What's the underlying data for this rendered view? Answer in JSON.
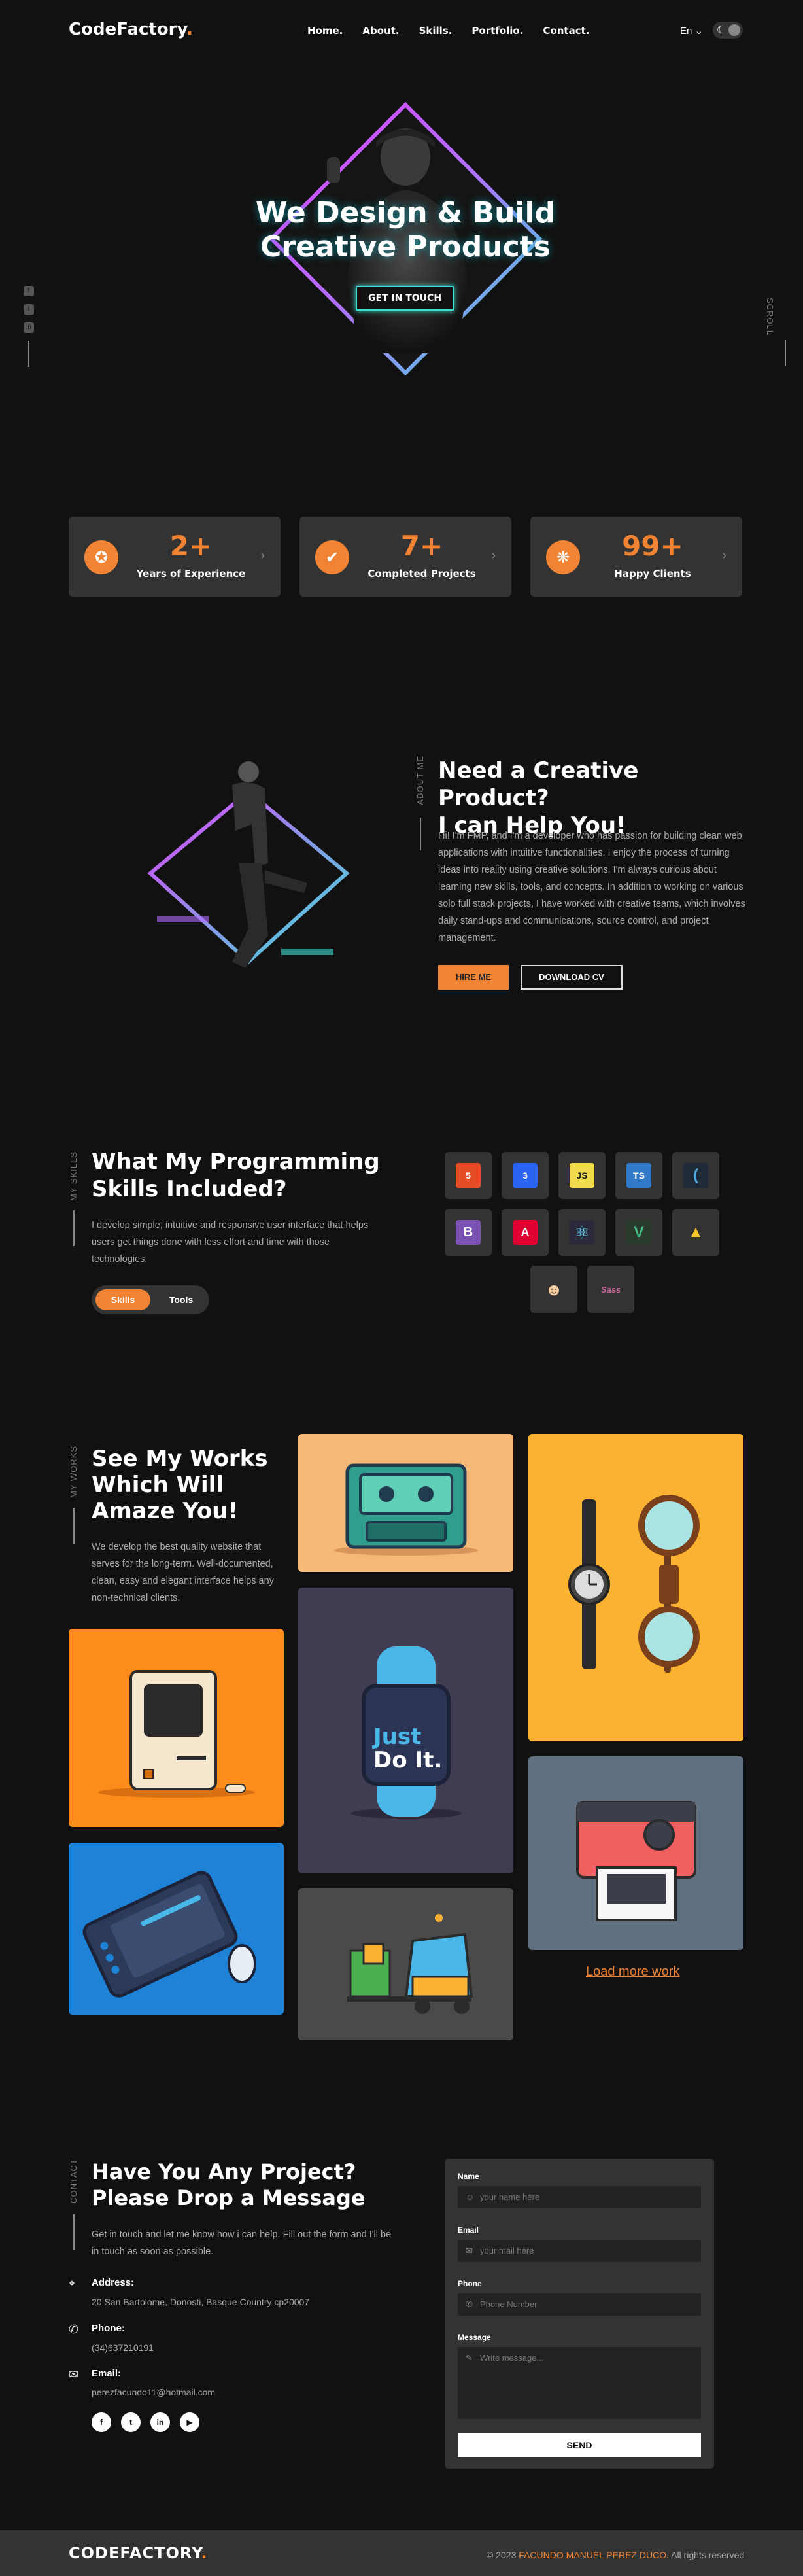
{
  "header": {
    "logo": "CodeFactory",
    "logo_dot": ".",
    "nav": [
      "Home.",
      "About.",
      "Skills.",
      "Portfolio.",
      "Contact."
    ],
    "lang": "En ⌄"
  },
  "side": {
    "scroll": "SCROLL"
  },
  "hero": {
    "title_line1": "We Design & Build",
    "title_line2": "Creative Products",
    "cta": "GET IN TOUCH"
  },
  "stats": [
    {
      "value": "2+",
      "label": "Years of Experience",
      "icon": "award-icon"
    },
    {
      "value": "7+",
      "label": "Completed Projects",
      "icon": "check-badge-icon"
    },
    {
      "value": "99+",
      "label": "Happy Clients",
      "icon": "group-icon"
    }
  ],
  "about": {
    "side": "ABOUT ME",
    "title_line1": "Need a Creative Product?",
    "title_line2": "I can Help You!",
    "text": "Hi! I'm FMP, and I'm a developer who has passion for building clean web applications with intuitive functionalities. I enjoy the process of turning ideas into reality using creative solutions. I'm always curious about learning new skills, tools, and concepts. In addition to working on various solo full stack projects, I have worked with creative teams, which involves daily stand-ups and communications, source control, and project management.",
    "hire": "HIRE ME",
    "cv": "DOWNLOAD CV"
  },
  "skills": {
    "side": "MY SKILLS",
    "title_line1": "What My Programming",
    "title_line2": "Skills Included?",
    "text": "I develop simple, intuitive and responsive user interface that helps users get things done with less effort and time with those technologies.",
    "tab_skills": "Skills",
    "tab_tools": "Tools",
    "items": [
      {
        "name": "html5-icon",
        "glyph": "5",
        "color": "#e44d26"
      },
      {
        "name": "css3-icon",
        "glyph": "3",
        "color": "#2965f1"
      },
      {
        "name": "javascript-icon",
        "glyph": "JS",
        "color": "#f0db4f"
      },
      {
        "name": "typescript-icon",
        "glyph": "TS",
        "color": "#3178c6"
      },
      {
        "name": "jquery-icon",
        "glyph": "(",
        "color": "#1e2a38"
      },
      {
        "name": "bootstrap-icon",
        "glyph": "B",
        "color": "#7952b3"
      },
      {
        "name": "angular-icon",
        "glyph": "A",
        "color": "#dd0031"
      },
      {
        "name": "react-icon",
        "glyph": "⚛",
        "color": "#2a2a3a"
      },
      {
        "name": "vue-icon",
        "glyph": "V",
        "color": "#2a3a2a"
      },
      {
        "name": "firebase-icon",
        "glyph": "▲",
        "color": "#ffca28"
      },
      {
        "name": "github-icon",
        "glyph": "☻",
        "color": "#2a2a2a"
      },
      {
        "name": "sass-icon",
        "glyph": "Sass",
        "color": "#2a2a2a"
      }
    ]
  },
  "works": {
    "side": "MY WORKS",
    "title_line1": "See My Works",
    "title_line2": "Which Will",
    "title_line3": "Amaze You!",
    "text": "We develop the best quality website that serves for the long-term. Well-documented, clean, easy and elegant interface helps any non-technical clients.",
    "watch_text_1": "Just",
    "watch_text_2": "Do It.",
    "load_more": "Load more work"
  },
  "contact": {
    "side": "CONTACT",
    "title_line1": "Have You Any Project?",
    "title_line2": "Please Drop a Message",
    "text": "Get in touch and let me know how i can help. Fill out the form and I'll be in touch as soon as possible.",
    "address_label": "Address:",
    "address": "20 San Bartolome, Donosti, Basque Country cp20007",
    "phone_label": "Phone:",
    "phone": "(34)637210191",
    "email_label": "Email:",
    "email": "perezfacundo11@hotmail.com",
    "socials": [
      "f",
      "t",
      "in",
      "▶"
    ]
  },
  "form": {
    "name_label": "Name",
    "name_placeholder": "your name here",
    "email_label": "Email",
    "email_placeholder": "your mail here",
    "phone_label": "Phone",
    "phone_placeholder": "Phone Number",
    "message_label": "Message",
    "message_placeholder": "Write message...",
    "send": "SEND"
  },
  "footer": {
    "logo": "CODEFACTORY",
    "logo_dot": ".",
    "copy_prefix": "© 2023",
    "copy_name": "FACUNDO MANUEL PEREZ DUCO.",
    "copy_suffix": "All rights reserved"
  },
  "colors": {
    "accent": "#f08434",
    "background": "#111111",
    "card": "#333333",
    "neon_cyan": "#3ee0d6",
    "neon_pink": "#e040fb"
  }
}
